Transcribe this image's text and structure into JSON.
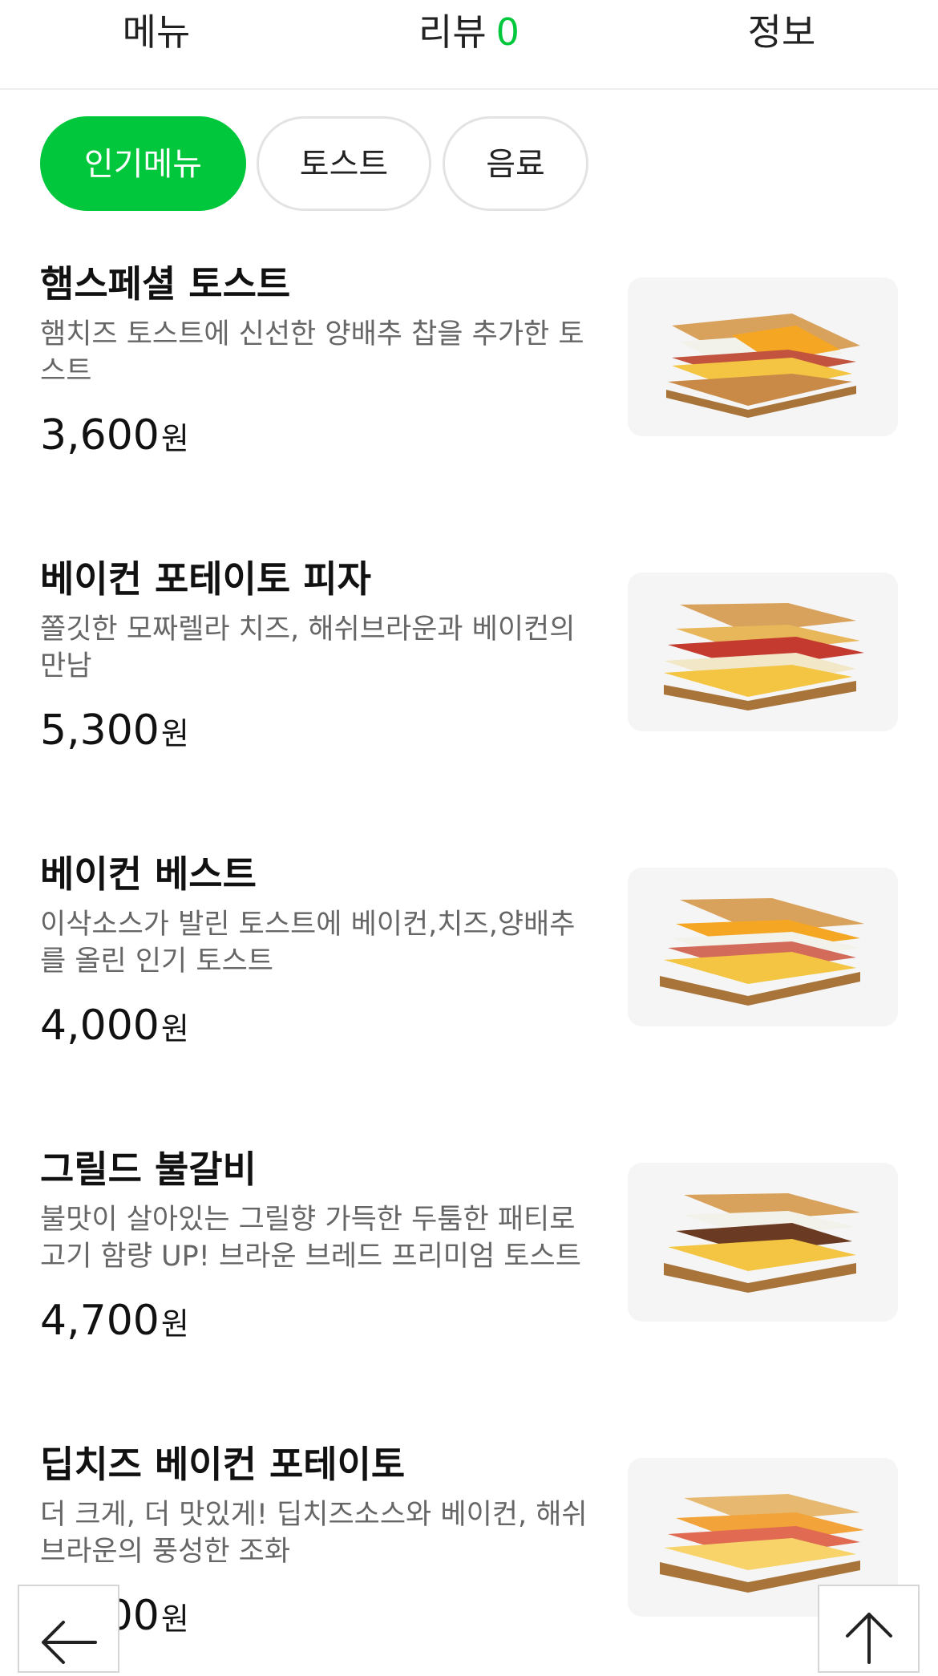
{
  "tabs": {
    "menu": "메뉴",
    "review": "리뷰",
    "review_count": "0",
    "info": "정보"
  },
  "chips": [
    "인기메뉴",
    "토스트",
    "음료"
  ],
  "items": [
    {
      "name": "햄스페셜 토스트",
      "desc": "햄치즈 토스트에 신선한 양배추 찹을 추가한 토스트",
      "price": "3,600",
      "currency": "원"
    },
    {
      "name": "베이컨 포테이토 피자",
      "desc": "쫄깃한 모짜렐라 치즈, 해쉬브라운과 베이컨의 만남",
      "price": "5,300",
      "currency": "원"
    },
    {
      "name": "베이컨 베스트",
      "desc": "이삭소스가 발린 토스트에 베이컨,치즈,양배추를 올린 인기 토스트",
      "price": "4,000",
      "currency": "원"
    },
    {
      "name": "그릴드 불갈비",
      "desc": "불맛이 살아있는 그릴향 가득한 두툼한 패티로 고기 함량 UP! 브라운 브레드 프리미엄 토스트",
      "price": "4,700",
      "currency": "원"
    },
    {
      "name": "딥치즈 베이컨 포테이토",
      "desc": "더 크게, 더 맛있게! 딥치즈소스와 베이컨, 해쉬브라운의 풍성한 조화",
      "price": "5,000",
      "currency": "원"
    }
  ],
  "colors": {
    "accent": "#00c73c",
    "thumb_bg": "#f5f5f5",
    "desc_text": "#666666"
  },
  "icons": {
    "back": "arrow-left-icon",
    "top": "arrow-up-icon"
  }
}
